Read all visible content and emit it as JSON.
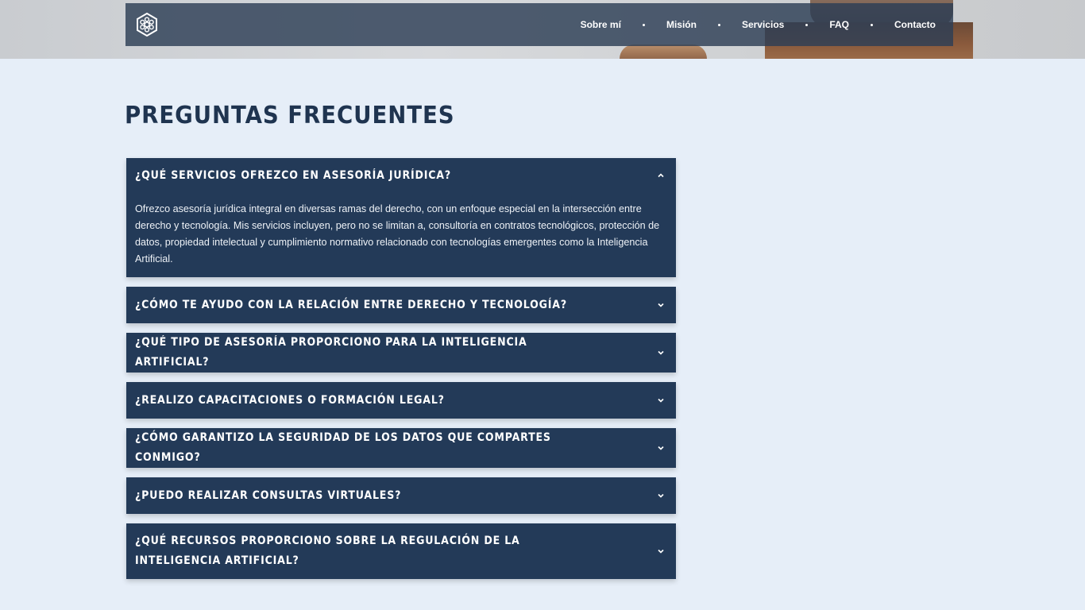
{
  "nav": {
    "links": [
      "Sobre mí",
      "Misión",
      "Servicios",
      "FAQ",
      "Contacto"
    ]
  },
  "faq": {
    "title": "PREGUNTAS FRECUENTES",
    "items": [
      {
        "question": "¿Qué servicios ofrezco en asesoría jurídica?",
        "answer": "Ofrezco asesoría jurídica integral en diversas ramas del derecho, con un enfoque especial en la intersección entre derecho y tecnología. Mis servicios incluyen, pero no se limitan a, consultoría en contratos tecnológicos, protección de datos, propiedad intelectual y cumplimiento normativo relacionado con tecnologías emergentes como la Inteligencia Artificial.",
        "expanded": true
      },
      {
        "question": "¿Cómo te ayudo con la relación entre derecho y tecnología?",
        "expanded": false
      },
      {
        "question": "¿Qué tipo de asesoría proporciono para la Inteligencia Artificial?",
        "expanded": false
      },
      {
        "question": "¿Realizo capacitaciones o formación legal?",
        "expanded": false
      },
      {
        "question": "¿Cómo garantizo la seguridad de los datos que compartes conmigo?",
        "expanded": false
      },
      {
        "question": "¿Puedo realizar consultas virtuales?",
        "expanded": false
      },
      {
        "question": "¿Qué recursos proporciono sobre la regulación de la Inteligencia Artificial?",
        "expanded": false
      }
    ]
  },
  "colors": {
    "page_bg": "#e6eef8",
    "accordion_bg": "#233a58",
    "title": "#1f3450",
    "nav_bg": "#2d3e56"
  },
  "icons": {
    "logo": "hexagon-network-logo",
    "expanded": "chevron-up-icon",
    "collapsed": "chevron-down-icon"
  }
}
